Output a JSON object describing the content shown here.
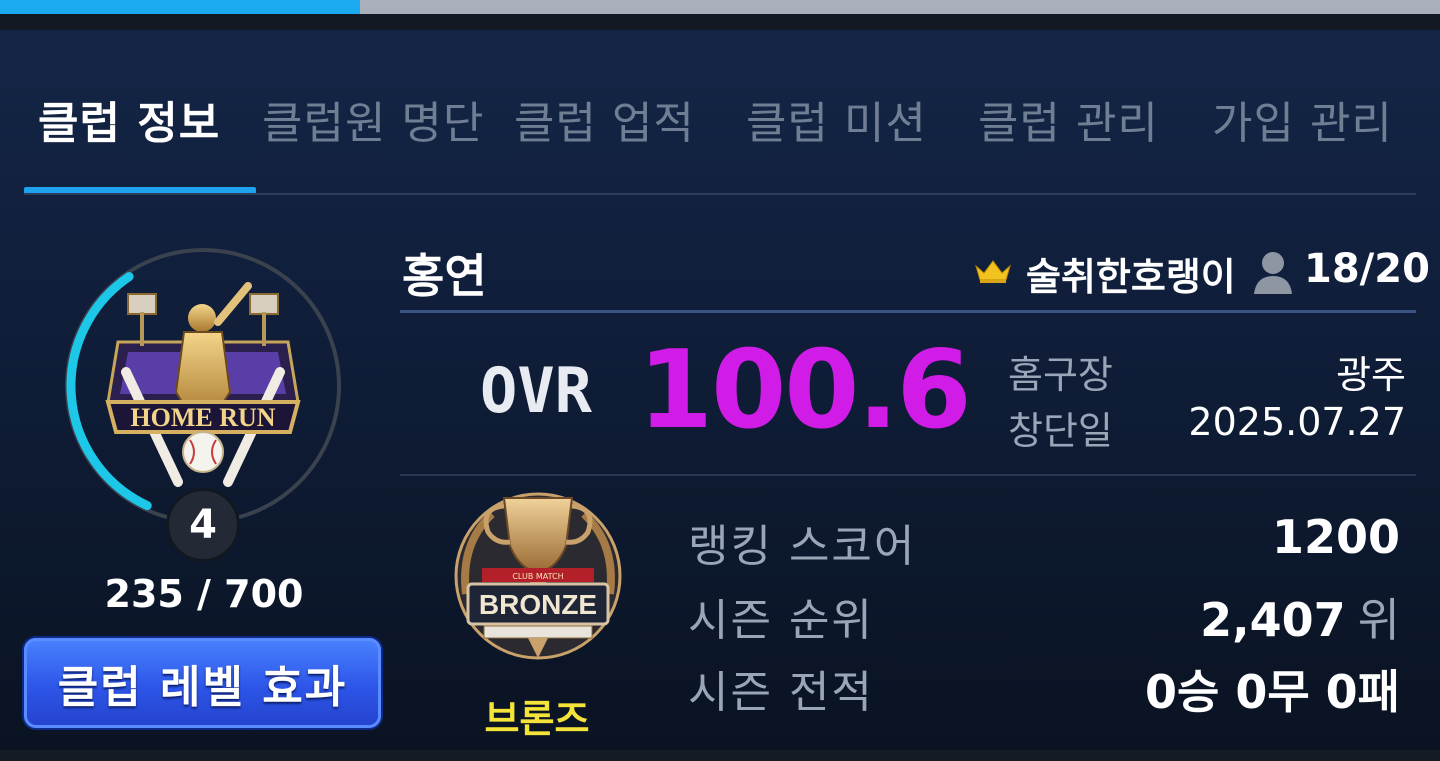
{
  "tabs": [
    {
      "label": "클럽 정보",
      "active": true
    },
    {
      "label": "클럽원 명단",
      "active": false
    },
    {
      "label": "클럽 업적",
      "active": false
    },
    {
      "label": "클럽 미션",
      "active": false
    },
    {
      "label": "클럽 관리",
      "active": false
    },
    {
      "label": "가입 관리",
      "active": false
    }
  ],
  "club": {
    "name": "홍연",
    "master": "술취한호랭이",
    "members": "18/20",
    "emblem_text": "HOME RUN",
    "level": "4",
    "exp_text": "235 / 700",
    "exp_progress": 0.336,
    "level_effect_button": "클럽 레벨 효과"
  },
  "ovr": {
    "label": "OVR",
    "value": "100.6"
  },
  "info": {
    "stadium_label": "홈구장",
    "stadium_value": "광주",
    "founded_label": "창단일",
    "founded_value": "2025.07.27"
  },
  "tier": {
    "emblem_text": "BRONZE",
    "emblem_subtext": "CLUB MATCH",
    "name": "브론즈"
  },
  "stats": {
    "ranking_score_label": "랭킹 스코어",
    "ranking_score_value": "1200",
    "season_rank_label": "시즌 순위",
    "season_rank_value": "2,407",
    "season_rank_unit": "위",
    "season_record_label": "시즌 전적",
    "season_record_value": "0승 0무 0패"
  },
  "colors": {
    "accent_blue": "#1ea4ee",
    "ovr_purple": "#d11ce8",
    "tier_yellow": "#f4e43a",
    "button_blue": "#2d55e8"
  },
  "icons": {
    "crown": "crown-icon",
    "member": "member-icon"
  }
}
